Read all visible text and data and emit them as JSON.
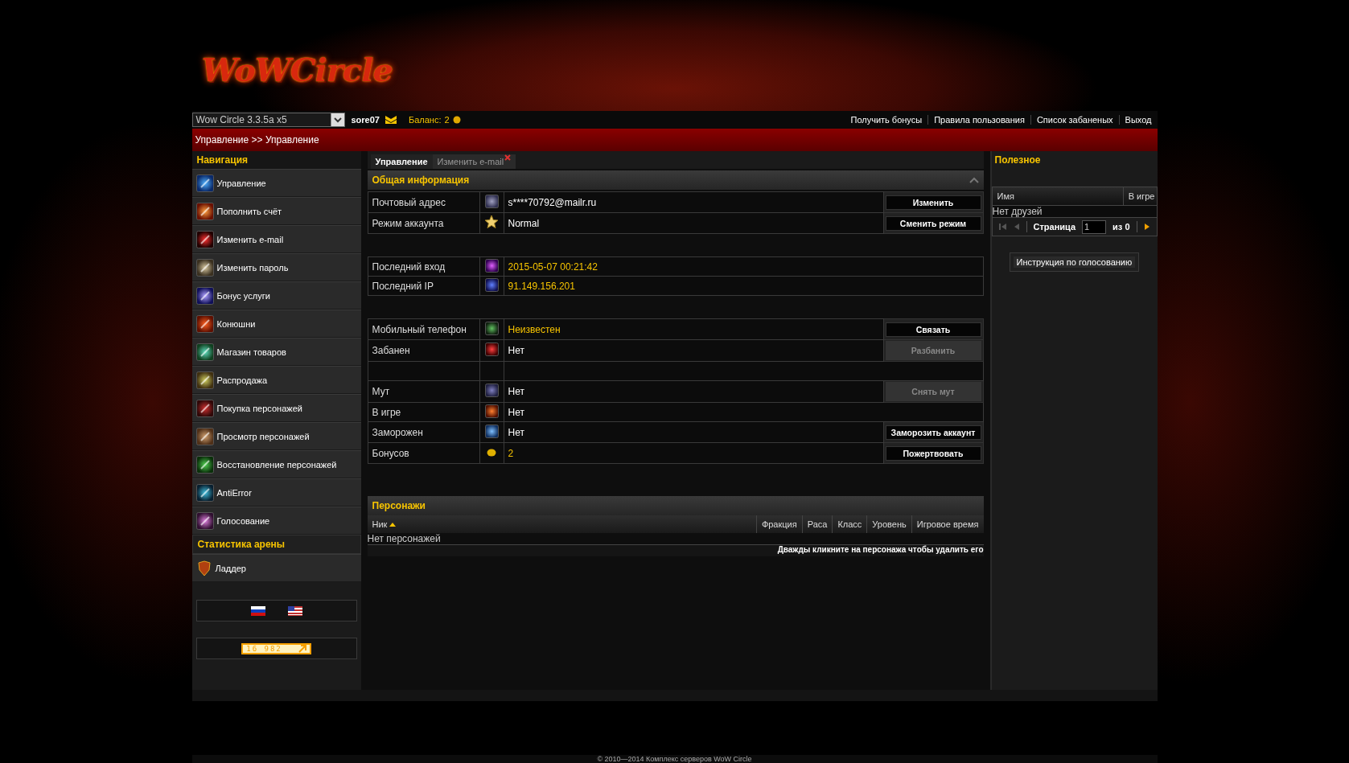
{
  "logo": "WoWCircle",
  "server_select": {
    "value": "Wow Circle 3.3.5a x5"
  },
  "user": "sore07",
  "balance": {
    "label": "Баланс:",
    "value": "2"
  },
  "top_links": [
    "Получить бонусы",
    "Правила пользования",
    "Список забаненых",
    "Выход"
  ],
  "breadcrumb": "Управление >> Управление",
  "navigation": {
    "title": "Навигация",
    "items": [
      {
        "label": "Управление"
      },
      {
        "label": "Пополнить счёт"
      },
      {
        "label": "Изменить e-mail"
      },
      {
        "label": "Изменить пароль"
      },
      {
        "label": "Бонус услуги"
      },
      {
        "label": "Конюшни"
      },
      {
        "label": "Магазин товаров"
      },
      {
        "label": "Распродажа"
      },
      {
        "label": "Покупка персонажей"
      },
      {
        "label": "Просмотр персонажей"
      },
      {
        "label": "Восстановление персонажей"
      },
      {
        "label": "AntiError"
      },
      {
        "label": "Голосование"
      }
    ]
  },
  "arena": {
    "title": "Статистика арены",
    "items": [
      {
        "label": "Ладдер"
      }
    ]
  },
  "counter": "16 982",
  "tabs": [
    {
      "label": "Управление",
      "selected": true,
      "closable": false
    },
    {
      "label": "Изменить e-mail",
      "selected": false,
      "closable": true
    }
  ],
  "general": {
    "title": "Общая информация",
    "groups": [
      [
        {
          "kind": "field",
          "label": "Почтовый адрес",
          "value": "s****70792@mailr.ru",
          "accent": false,
          "action": {
            "label": "Изменить",
            "disabled": false
          }
        },
        {
          "kind": "field",
          "label": "Режим аккаунта",
          "value": "Normal",
          "accent": false,
          "action": {
            "label": "Сменить режим",
            "disabled": false
          }
        }
      ],
      [
        {
          "kind": "field",
          "label": "Последний вход",
          "value": "2015-05-07 00:21:42",
          "accent": true
        },
        {
          "kind": "field",
          "label": "Последний IP",
          "value": "91.149.156.201",
          "accent": true
        }
      ],
      [
        {
          "kind": "field",
          "label": "Мобильный телефон",
          "value": "Неизвестен",
          "accent": true,
          "action": {
            "label": "Связать",
            "disabled": false
          }
        },
        {
          "kind": "field",
          "label": "Забанен",
          "value": "Нет",
          "accent": false,
          "action": {
            "label": "Разбанить",
            "disabled": true
          }
        },
        {
          "kind": "blank"
        },
        {
          "kind": "field",
          "label": "Мут",
          "value": "Нет",
          "accent": false,
          "action": {
            "label": "Снять мут",
            "disabled": true
          }
        },
        {
          "kind": "field",
          "label": "В игре",
          "value": "Нет",
          "accent": false
        },
        {
          "kind": "field",
          "label": "Заморожен",
          "value": "Нет",
          "accent": false,
          "action": {
            "label": "Заморозить аккаунт",
            "disabled": false
          }
        },
        {
          "kind": "field",
          "label": "Бонусов",
          "value": "2",
          "accent": true,
          "action": {
            "label": "Пожертвовать",
            "disabled": false
          }
        }
      ]
    ]
  },
  "characters": {
    "title": "Персонажи",
    "columns": [
      {
        "label": "Ник",
        "sorted": true
      },
      {
        "label": "Фракция",
        "sorted": false
      },
      {
        "label": "Раса",
        "sorted": false
      },
      {
        "label": "Класс",
        "sorted": false
      },
      {
        "label": "Уровень",
        "sorted": false
      },
      {
        "label": "Игровое время",
        "sorted": false
      }
    ],
    "empty": "Нет персонажей",
    "hint": "Дважды кликните на персонажа чтобы удалить его"
  },
  "useful": {
    "title": "Полезное",
    "columns": [
      "Имя",
      "В игре"
    ],
    "empty": "Нет друзей",
    "pager": {
      "label": "Страница",
      "page": "1",
      "of": "из 0"
    },
    "button": "Инструкция по голосованию"
  },
  "footer": "© 2010—2014 Комплекс серверов WoW Circle"
}
